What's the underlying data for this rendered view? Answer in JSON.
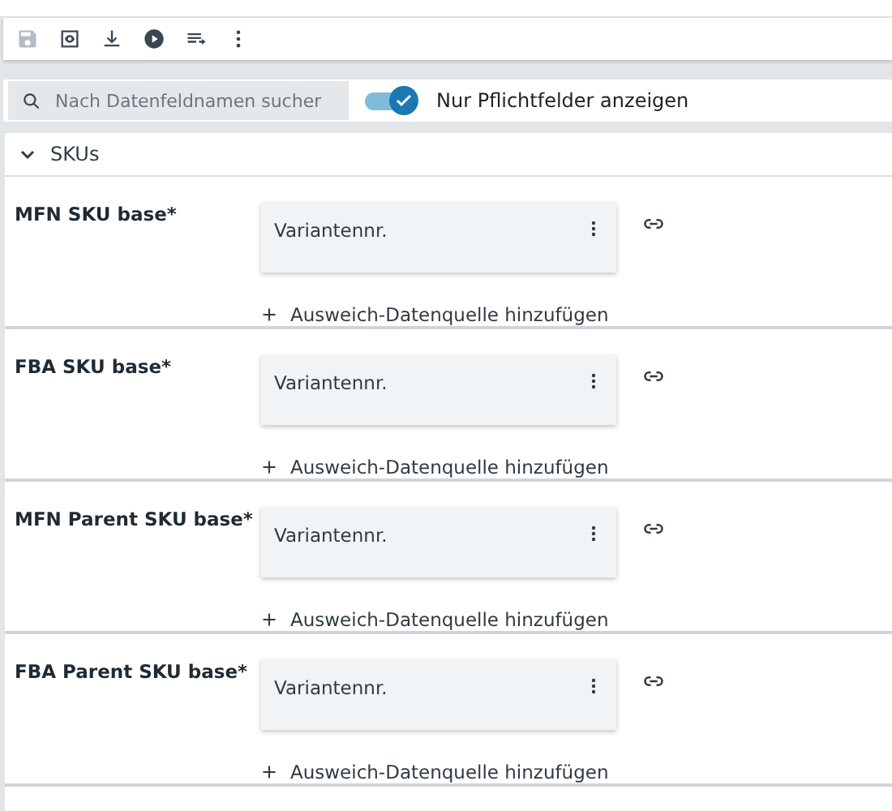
{
  "toolbar": {
    "save_disabled": true
  },
  "search": {
    "placeholder": "Nach Datenfeldnamen sucher"
  },
  "required_toggle": {
    "label": "Nur Pflichtfelder anzeigen",
    "on": true
  },
  "section": {
    "title": "SKUs",
    "expanded": true,
    "fields": [
      {
        "label": "MFN SKU base*",
        "source": "Variantennr.",
        "add_fallback": "Ausweich-Datenquelle hinzufügen"
      },
      {
        "label": "FBA SKU base*",
        "source": "Variantennr.",
        "add_fallback": "Ausweich-Datenquelle hinzufügen"
      },
      {
        "label": "MFN Parent SKU base*",
        "source": "Variantennr.",
        "add_fallback": "Ausweich-Datenquelle hinzufügen"
      },
      {
        "label": "FBA Parent SKU base*",
        "source": "Variantennr.",
        "add_fallback": "Ausweich-Datenquelle hinzufügen"
      }
    ]
  }
}
